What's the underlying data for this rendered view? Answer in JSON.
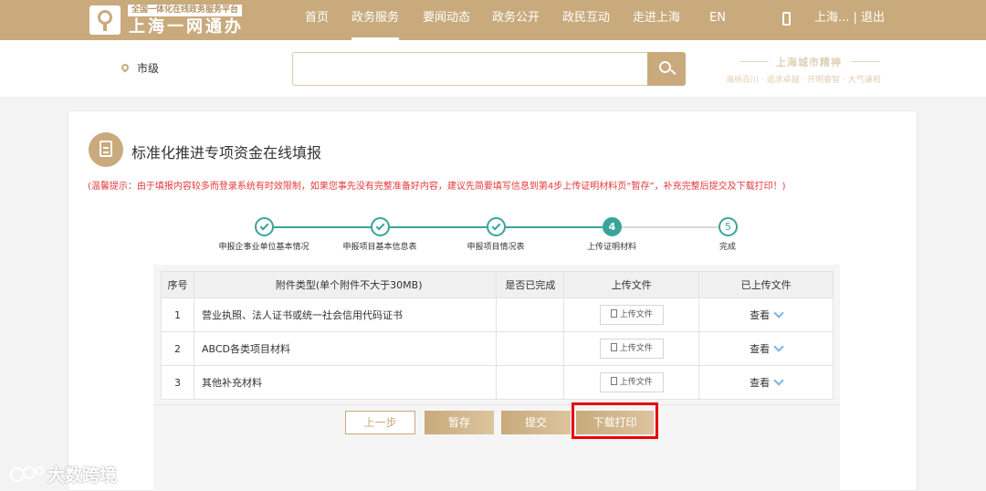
{
  "header": {
    "tagline": "全国一体化在线政务服务平台",
    "brand": "上海一网通办",
    "nav": [
      "首页",
      "政务服务",
      "要闻动态",
      "政务公开",
      "政民互动",
      "走进上海",
      "EN"
    ],
    "user": "上海... | 退出"
  },
  "search": {
    "region": "市级",
    "placeholder": "",
    "slogan_title": "上海城市精神",
    "slogan_sub": "海纳百川 · 追求卓越 · 开明睿智 · 大气谦和"
  },
  "page": {
    "title": "标准化推进专项资金在线填报",
    "tip": "(温馨提示：由于填报内容较多而登录系统有时效限制，如果您事先没有完整准备好内容，建议先简要填写信息到第4步上传证明材料页“暂存”，补充完整后提交及下载打印！)"
  },
  "steps": [
    {
      "number": "1",
      "label": "申报企事业单位基本情况",
      "state": "done"
    },
    {
      "number": "2",
      "label": "申报项目基本信息表",
      "state": "done"
    },
    {
      "number": "3",
      "label": "申报项目情况表",
      "state": "done"
    },
    {
      "number": "4",
      "label": "上传证明材料",
      "state": "current"
    },
    {
      "number": "5",
      "label": "完成",
      "state": "todo"
    }
  ],
  "table": {
    "headers": [
      "序号",
      "附件类型(单个附件不大于30MB)",
      "是否已完成",
      "上传文件",
      "已上传文件"
    ],
    "rows": [
      {
        "no": "1",
        "type": "营业执照、法人证书或统一社会信用代码证书",
        "done": "",
        "upload": "上传文件",
        "view": "查看"
      },
      {
        "no": "2",
        "type": "ABCD各类项目材料",
        "done": "",
        "upload": "上传文件",
        "view": "查看"
      },
      {
        "no": "3",
        "type": "其他补充材料",
        "done": "",
        "upload": "上传文件",
        "view": "查看"
      }
    ]
  },
  "buttons": {
    "prev": "上一步",
    "save": "暂存",
    "submit": "提交",
    "download": "下载打印"
  },
  "watermark": "大数跨境",
  "colors": {
    "accent": "#c8aa7c",
    "step": "#3aa49a",
    "tip": "#e4393c",
    "highlight": "#e8000b"
  }
}
